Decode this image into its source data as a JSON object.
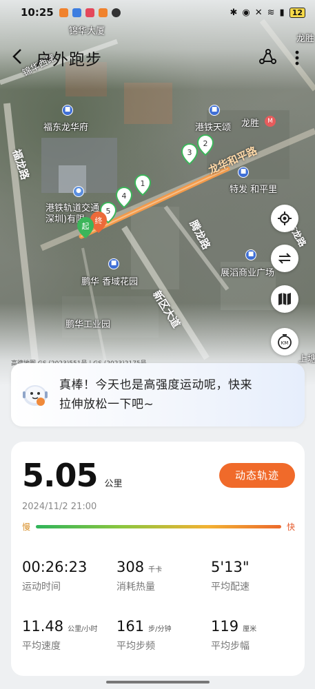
{
  "status_bar": {
    "time": "10:25",
    "battery": "12",
    "icons": [
      "bluetooth-icon",
      "location-icon",
      "mute-icon",
      "wifi-icon",
      "signal-icon"
    ]
  },
  "header": {
    "title": "户外跑步",
    "share_icon": "route-share-icon",
    "more_icon": "more-vertical-icon"
  },
  "map": {
    "road_labels": [
      "龙华和平路",
      "福龙路",
      "腾龙路",
      "新区大道",
      "布龙路"
    ],
    "pois": [
      "锦华大厦",
      "福东龙华府",
      "港铁天颂",
      "龙胜",
      "特发 和平里",
      "港铁轨道交通",
      "深圳)有限",
      "鹏华 香域花园",
      "鹏华工业园",
      "展滔商业广场",
      "锦华西路",
      "龙胜",
      "上塘"
    ],
    "markers": [
      "起",
      "终",
      "1",
      "2",
      "3",
      "4",
      "5"
    ],
    "controls": [
      "locate-icon",
      "switch-icon",
      "map-layers-icon",
      "km-icon"
    ],
    "attribution": "高德地图  GS (2023)551号 | GS (2023)2175号"
  },
  "motivation": {
    "text_line1": "真棒！今天也是高强度运动呢，快来",
    "text_line2": "拉伸放松一下吧~"
  },
  "summary": {
    "distance": "5.05",
    "distance_unit": "公里",
    "track_button": "动态轨迹",
    "datetime": "2024/11/2 21:00",
    "pace_slow": "慢",
    "pace_fast": "快"
  },
  "metrics": [
    {
      "value": "00:26:23",
      "unit": "",
      "label": "运动时间"
    },
    {
      "value": "308",
      "unit": "千卡",
      "label": "消耗热量"
    },
    {
      "value": "5'13\"",
      "unit": "",
      "label": "平均配速"
    },
    {
      "value": "11.48",
      "unit": "公里/小时",
      "label": "平均速度"
    },
    {
      "value": "161",
      "unit": "步/分钟",
      "label": "平均步频"
    },
    {
      "value": "119",
      "unit": "厘米",
      "label": "平均步幅"
    }
  ],
  "colors": {
    "accent": "#f06a2a",
    "route": "#f08a3a",
    "marker_green": "#3cb55a"
  }
}
